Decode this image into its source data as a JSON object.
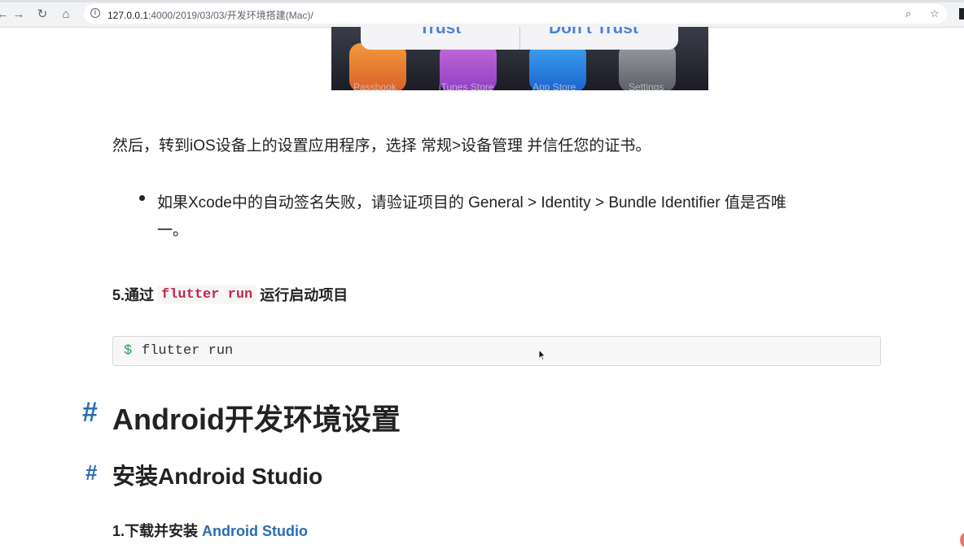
{
  "browser": {
    "url_host": "127.0.0.1",
    "url_path": ":4000/2019/03/03/开发环境搭建(Mac)/"
  },
  "image": {
    "alert_buttons": [
      "Trust",
      "Don't Trust"
    ],
    "app_labels": [
      "Passbook",
      "iTunes Store",
      "App Store",
      "Settings"
    ]
  },
  "content": {
    "paragraph": "然后，转到iOS设备上的设置应用程序，选择 常规>设备管理 并信任您的证书。",
    "bullet_line1": "如果Xcode中的自动签名失败，请验证项目的 General > Identity > Bundle Identifier 值是否唯",
    "bullet_line2": "一。",
    "step5_prefix": "5.通过",
    "step5_code": "flutter run",
    "step5_suffix": "运行启动项目",
    "code_prompt": "$",
    "code_command": "flutter run",
    "heading1_hash": "#",
    "heading1": "Android开发环境设置",
    "heading2_hash": "#",
    "heading2": "安装Android Studio",
    "step1_prefix": "1.下载并安装",
    "step1_link": "Android Studio"
  }
}
